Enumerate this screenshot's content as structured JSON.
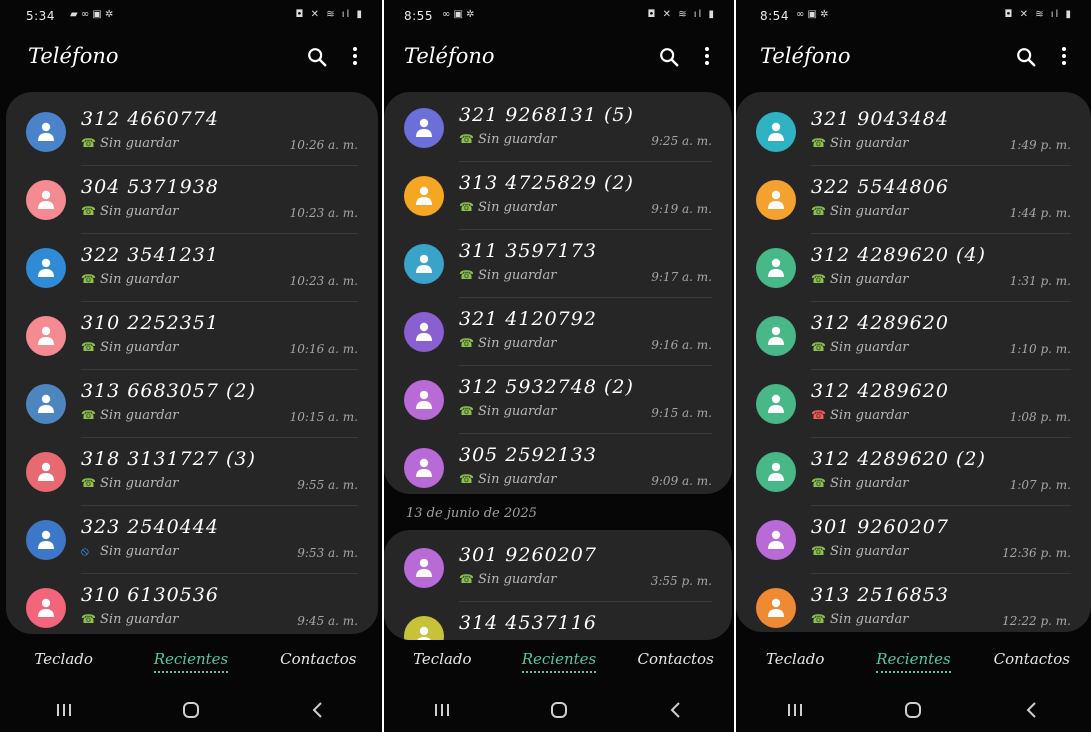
{
  "colors": {
    "accent": "#52c7a5",
    "card": "#262626",
    "missed": "#ff5a4f",
    "blocked": "#3aa7ff"
  },
  "screens": [
    {
      "status_time": "5:34",
      "title": "Teléfono",
      "calls": [
        {
          "number": "312 4660774",
          "label": "Sin guardar",
          "time": "10:26 a. m.",
          "avatar": "#4a83c9",
          "call_icon": "incoming-call-icon"
        },
        {
          "number": "304 5371938",
          "label": "Sin guardar",
          "time": "10:23 a. m.",
          "avatar": "#f48b93",
          "call_icon": "incoming-call-icon"
        },
        {
          "number": "322 3541231",
          "label": "Sin guardar",
          "time": "10:23 a. m.",
          "avatar": "#2f8bd5",
          "call_icon": "incoming-call-icon"
        },
        {
          "number": "310 2252351",
          "label": "Sin guardar",
          "time": "10:16 a. m.",
          "avatar": "#f48b93",
          "call_icon": "incoming-call-icon"
        },
        {
          "number": "313 6683057 (2)",
          "label": "Sin guardar",
          "time": "10:15 a. m.",
          "avatar": "#4d86bf",
          "call_icon": "incoming-call-icon"
        },
        {
          "number": "318 3131727 (3)",
          "label": "Sin guardar",
          "time": "9:55 a. m.",
          "avatar": "#e66a6f",
          "call_icon": "incoming-call-icon"
        },
        {
          "number": "323 2540444",
          "label": "Sin guardar",
          "time": "9:53 a. m.",
          "avatar": "#3c78c7",
          "call_icon": "blocked-call-icon"
        },
        {
          "number": "310 6130536",
          "label": "Sin guardar",
          "time": "9:45 a. m.",
          "avatar": "#f2657a",
          "call_icon": "incoming-call-icon"
        }
      ]
    },
    {
      "status_time": "8:55",
      "title": "Teléfono",
      "calls": [
        {
          "number": "321 9268131 (5)",
          "label": "Sin guardar",
          "time": "9:25 a. m.",
          "avatar": "#6c6ed9",
          "call_icon": "incoming-call-icon"
        },
        {
          "number": "313 4725829 (2)",
          "label": "Sin guardar",
          "time": "9:19 a. m.",
          "avatar": "#f5a623",
          "call_icon": "incoming-call-icon"
        },
        {
          "number": "311 3597173",
          "label": "Sin guardar",
          "time": "9:17 a. m.",
          "avatar": "#3aa3c9",
          "call_icon": "incoming-call-icon"
        },
        {
          "number": "321 4120792",
          "label": "Sin guardar",
          "time": "9:16 a. m.",
          "avatar": "#8a5fd0",
          "call_icon": "incoming-call-icon"
        },
        {
          "number": "312 5932748 (2)",
          "label": "Sin guardar",
          "time": "9:15 a. m.",
          "avatar": "#b86ad6",
          "call_icon": "incoming-call-icon"
        },
        {
          "number": "305 2592133",
          "label": "Sin guardar",
          "time": "9:09 a. m.",
          "avatar": "#b86ad6",
          "call_icon": "incoming-call-icon"
        }
      ],
      "section_label": "13 de junio de 2025",
      "calls2": [
        {
          "number": "301 9260207",
          "label": "Sin guardar",
          "time": "3:55 p. m.",
          "avatar": "#b86ad6",
          "call_icon": "incoming-call-icon"
        },
        {
          "number": "314 4537116",
          "label": "",
          "time": "",
          "avatar": "#c8c23a",
          "call_icon": ""
        }
      ]
    },
    {
      "status_time": "8:54",
      "title": "Teléfono",
      "calls": [
        {
          "number": "321 9043484",
          "label": "Sin guardar",
          "time": "1:49 p. m.",
          "avatar": "#2fb3c4",
          "call_icon": "incoming-call-icon"
        },
        {
          "number": "322 5544806",
          "label": "Sin guardar",
          "time": "1:44 p. m.",
          "avatar": "#f5a130",
          "call_icon": "incoming-call-icon"
        },
        {
          "number": "312 4289620 (4)",
          "label": "Sin guardar",
          "time": "1:31 p. m.",
          "avatar": "#48b889",
          "call_icon": "incoming-call-icon"
        },
        {
          "number": "312 4289620",
          "label": "Sin guardar",
          "time": "1:10 p. m.",
          "avatar": "#48b889",
          "call_icon": "outgoing-call-icon"
        },
        {
          "number": "312 4289620",
          "label": "Sin guardar",
          "time": "1:08 p. m.",
          "avatar": "#48b889",
          "call_icon": "missed-call-icon"
        },
        {
          "number": "312 4289620 (2)",
          "label": "Sin guardar",
          "time": "1:07 p. m.",
          "avatar": "#48b889",
          "call_icon": "incoming-call-icon"
        },
        {
          "number": "301 9260207",
          "label": "Sin guardar",
          "time": "12:36 p. m.",
          "avatar": "#b86ad6",
          "call_icon": "incoming-call-icon"
        },
        {
          "number": "313 2516853",
          "label": "Sin guardar",
          "time": "12:22 p. m.",
          "avatar": "#ef8a33",
          "call_icon": "incoming-call-icon"
        }
      ]
    }
  ],
  "tabs": [
    "Teclado",
    "Recientes",
    "Contactos"
  ]
}
